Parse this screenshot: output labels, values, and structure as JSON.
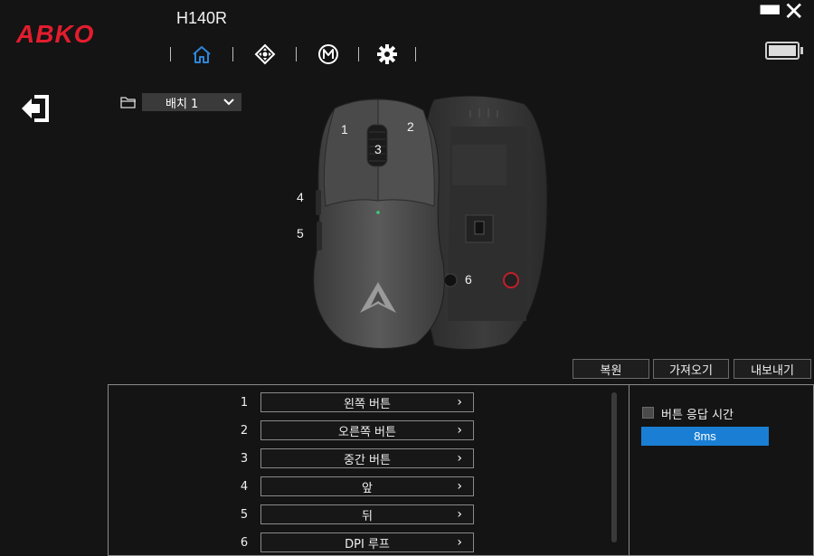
{
  "app": {
    "logo": "ABKO",
    "device_title": "H140R"
  },
  "window": {
    "minimize_icon": "minimize-icon",
    "close_icon": "close-icon",
    "battery_icon": "battery-icon"
  },
  "nav": {
    "items": [
      "home-icon",
      "direction-pad-icon",
      "macro-icon",
      "gear-icon"
    ],
    "active": "home-icon",
    "accent": "#2f86d8"
  },
  "profile": {
    "selected": "배치 1"
  },
  "mouse_labels": [
    "1",
    "2",
    "3",
    "4",
    "5",
    "6"
  ],
  "actions": {
    "restore": "복원",
    "import": "가져오기",
    "export": "내보내기"
  },
  "button_rows": [
    {
      "num": "1",
      "label": "왼쪽 버튼"
    },
    {
      "num": "2",
      "label": "오른쪽 버튼"
    },
    {
      "num": "3",
      "label": "중간 버튼"
    },
    {
      "num": "4",
      "label": "앞"
    },
    {
      "num": "5",
      "label": "뒤"
    },
    {
      "num": "6",
      "label": "DPI 루프"
    }
  ],
  "response": {
    "checkbox_label": "버튼 응답 시간",
    "checked": false,
    "value": "8ms",
    "color": "#1a7fd4"
  },
  "colors": {
    "brand": "#e21d2e",
    "background": "#141414"
  }
}
